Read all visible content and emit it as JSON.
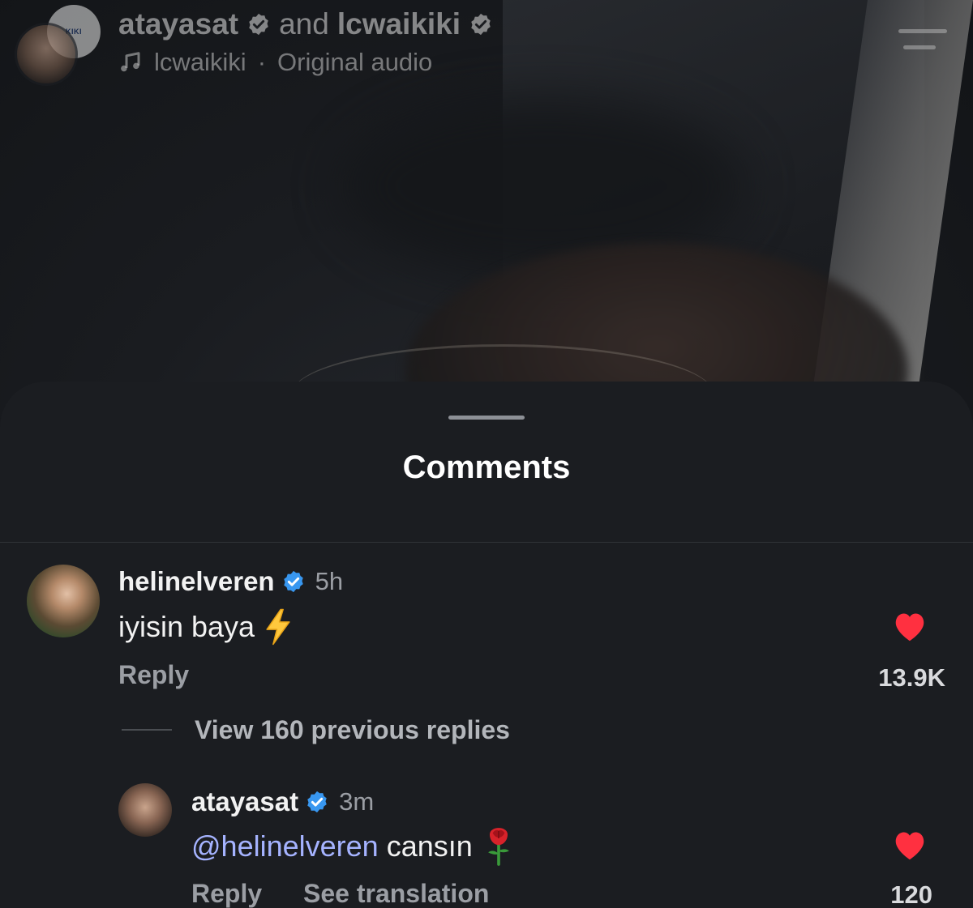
{
  "header": {
    "creator_primary": "atayasat",
    "conjunction": "and",
    "creator_secondary": "lcwaikiki",
    "audio_icon": "music-note-icon",
    "audio_source": "lcwaikiki",
    "audio_separator": "·",
    "audio_title": "Original audio",
    "menu_icon": "menu-icon",
    "brand_avatar_text": "KIKI"
  },
  "sheet": {
    "title": "Comments"
  },
  "comments": [
    {
      "username": "helinelveren",
      "verified": true,
      "time": "5h",
      "text": "iyisin baya",
      "emoji": "lightning-emoji",
      "reply_label": "Reply",
      "likes": "13.9K",
      "liked": true
    }
  ],
  "view_replies": {
    "label": "View 160 previous replies"
  },
  "replies": [
    {
      "username": "atayasat",
      "verified": true,
      "time": "3m",
      "mention": "@helinelveren",
      "text": "cansın",
      "emoji": "rose-emoji",
      "reply_label": "Reply",
      "translation_label": "See translation",
      "likes": "120",
      "liked": true
    }
  ],
  "colors": {
    "heart": "#ff3040",
    "verified_blue": "#3897f0",
    "mention": "#a5b3ff",
    "sheet_bg": "#1b1d21"
  }
}
